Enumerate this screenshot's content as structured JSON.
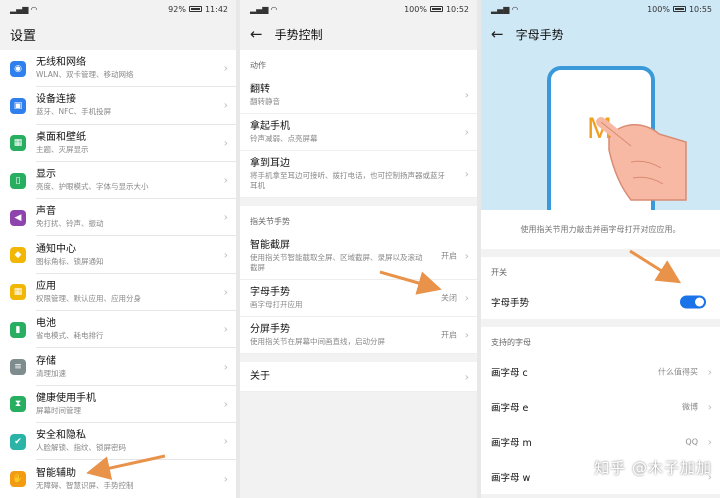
{
  "status_bars": [
    {
      "battery": "92%",
      "time": "11:42"
    },
    {
      "battery": "100%",
      "time": "10:52"
    },
    {
      "battery": "100%",
      "time": "10:55"
    }
  ],
  "settings": {
    "title": "设置",
    "items": [
      {
        "title": "无线和网络",
        "sub": "WLAN、双卡管理、移动网络",
        "icon": "wifi-icon",
        "color": "#2f80ed",
        "glyph": "◉"
      },
      {
        "title": "设备连接",
        "sub": "蓝牙、NFC、手机投屏",
        "icon": "device-connection-icon",
        "color": "#2f80ed",
        "glyph": "▣"
      },
      {
        "title": "桌面和壁纸",
        "sub": "主题、灭屏显示",
        "icon": "wallpaper-icon",
        "color": "#27ae60",
        "glyph": "▦"
      },
      {
        "title": "显示",
        "sub": "亮度、护眼模式、字体与显示大小",
        "icon": "display-icon",
        "color": "#27ae60",
        "glyph": "▯"
      },
      {
        "title": "声音",
        "sub": "免打扰、铃声、振动",
        "icon": "sound-icon",
        "color": "#8e44ad",
        "glyph": "◀"
      },
      {
        "title": "通知中心",
        "sub": "图标角标、锁屏通知",
        "icon": "bell-icon",
        "color": "#f2b705",
        "glyph": "◆"
      },
      {
        "title": "应用",
        "sub": "权限管理、默认应用、应用分身",
        "icon": "apps-icon",
        "color": "#f2b705",
        "glyph": "▦"
      },
      {
        "title": "电池",
        "sub": "省电模式、耗电排行",
        "icon": "battery-icon",
        "color": "#27ae60",
        "glyph": "▮"
      },
      {
        "title": "存储",
        "sub": "清理加速",
        "icon": "storage-icon",
        "color": "#7f8c8d",
        "glyph": "≡"
      },
      {
        "title": "健康使用手机",
        "sub": "屏幕时间管理",
        "icon": "hourglass-icon",
        "color": "#27ae60",
        "glyph": "⧗"
      },
      {
        "title": "安全和隐私",
        "sub": "人脸解锁、指纹、锁屏密码",
        "icon": "shield-icon",
        "color": "#2bb3a8",
        "glyph": "✔"
      },
      {
        "title": "智能辅助",
        "sub": "无障碍、智慧识屏、手势控制",
        "icon": "hand-icon",
        "color": "#f39c12",
        "glyph": "✋"
      }
    ]
  },
  "gestures": {
    "title": "手势控制",
    "section1": "动作",
    "actions": [
      {
        "title": "翻转",
        "sub": "翻转静音"
      },
      {
        "title": "拿起手机",
        "sub": "铃声减弱、点亮屏幕"
      },
      {
        "title": "拿到耳边",
        "sub": "将手机拿至耳边可接听、拨打电话，也可控制扬声器或蓝牙耳机"
      }
    ],
    "section2": "指关节手势",
    "knuckle": [
      {
        "title": "智能截屏",
        "sub": "使用指关节智能截取全屏、区域截屏、录屏以及滚动截屏",
        "state": "开启"
      },
      {
        "title": "字母手势",
        "sub": "画字母打开应用",
        "state": "关闭"
      },
      {
        "title": "分屏手势",
        "sub": "使用指关节在屏幕中间画直线，启动分屏",
        "state": "开启"
      }
    ],
    "about": "关于"
  },
  "letter": {
    "title": "字母手势",
    "banner_letter": "M",
    "description": "使用指关节用力敲击并画字母打开对应应用。",
    "switch_section": "开关",
    "switch_label": "字母手势",
    "switch_on": true,
    "supported_section": "支持的字母",
    "letters": [
      {
        "label": "画字母 c",
        "app": "什么值得买"
      },
      {
        "label": "画字母 e",
        "app": "微博"
      },
      {
        "label": "画字母 m",
        "app": "QQ"
      },
      {
        "label": "画字母 w",
        "app": ""
      }
    ],
    "watermark": "知乎 @木子加加"
  },
  "colors": {
    "accent": "#1a73e8",
    "arrow": "#e8924a",
    "banner": "#cfe8f5"
  }
}
